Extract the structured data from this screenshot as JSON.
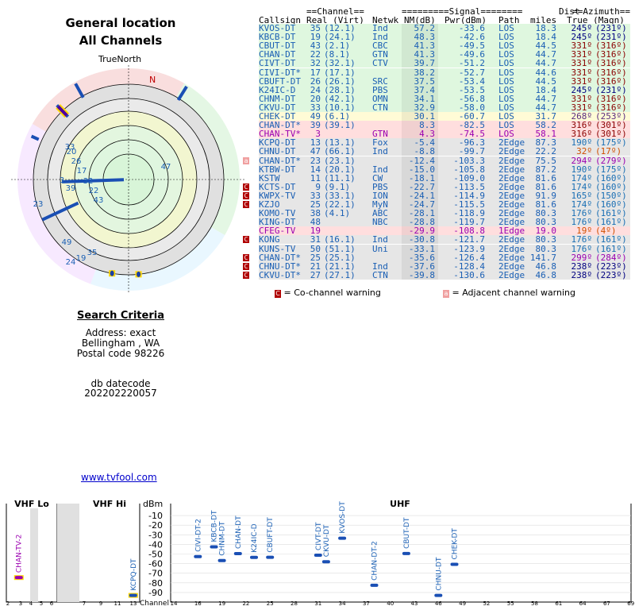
{
  "header": {
    "title1": "General location",
    "title2": "All Channels",
    "north_label": "TrueNorth",
    "magnetic_label": "N"
  },
  "table_headers": {
    "group_channel": "==Channel==",
    "group_signal": "=========Signal========",
    "group_dist": "Dist",
    "group_azimuth": "==Azimuth==",
    "callsign": "Callsign",
    "real_virt": "Real (Virt)",
    "netwk": "Netwk",
    "nm": "NM(dB)",
    "pwr": "Pwr(dBm)",
    "path": "Path",
    "miles": "miles",
    "true_magn": "True (Magn)"
  },
  "stations": [
    {
      "callsign": "KVOS-DT",
      "real": "35",
      "virt": "(12.1)",
      "netwk": "Ind",
      "nm": "57.2",
      "pwr": "-33.6",
      "path": "LOS",
      "dist": "18.3",
      "az": "245º",
      "magn": "(231º)",
      "bg": "#dff7df",
      "color": "#1a5fb4",
      "azcolor": "#000080",
      "warn": ""
    },
    {
      "callsign": "KBCB-DT",
      "real": "19",
      "virt": "(24.1)",
      "netwk": "Ind",
      "nm": "48.3",
      "pwr": "-42.6",
      "path": "LOS",
      "dist": "18.4",
      "az": "245º",
      "magn": "(231º)",
      "bg": "#dff7df",
      "color": "#1a5fb4",
      "azcolor": "#000080",
      "warn": ""
    },
    {
      "callsign": "CBUT-DT",
      "real": "43",
      "virt": "(2.1)",
      "netwk": "CBC",
      "nm": "41.3",
      "pwr": "-49.5",
      "path": "LOS",
      "dist": "44.5",
      "az": "331º",
      "magn": "(316º)",
      "bg": "#dff7df",
      "color": "#1a5fb4",
      "azcolor": "#8b0000",
      "warn": ""
    },
    {
      "callsign": "CHAN-DT",
      "real": "22",
      "virt": "(8.1)",
      "netwk": "GTN",
      "nm": "41.3",
      "pwr": "-49.6",
      "path": "LOS",
      "dist": "44.7",
      "az": "331º",
      "magn": "(316º)",
      "bg": "#dff7df",
      "color": "#1a5fb4",
      "azcolor": "#8b0000",
      "warn": ""
    },
    {
      "callsign": "CIVT-DT",
      "real": "32",
      "virt": "(32.1)",
      "netwk": "CTV",
      "nm": "39.7",
      "pwr": "-51.2",
      "path": "LOS",
      "dist": "44.7",
      "az": "331º",
      "magn": "(316º)",
      "bg": "#dff7df",
      "color": "#1a5fb4",
      "azcolor": "#8b0000",
      "warn": ""
    },
    {
      "callsign": "CIVI-DT*",
      "real": "17",
      "virt": "(17.1)",
      "netwk": "",
      "nm": "38.2",
      "pwr": "-52.7",
      "path": "LOS",
      "dist": "44.6",
      "az": "331º",
      "magn": "(316º)",
      "bg": "#dff7df",
      "color": "#1a5fb4",
      "azcolor": "#8b0000",
      "warn": ""
    },
    {
      "callsign": "CBUFT-DT",
      "real": "26",
      "virt": "(26.1)",
      "netwk": "SRC",
      "nm": "37.5",
      "pwr": "-53.4",
      "path": "LOS",
      "dist": "44.5",
      "az": "331º",
      "magn": "(316º)",
      "bg": "#dff7df",
      "color": "#1a5fb4",
      "azcolor": "#8b0000",
      "warn": ""
    },
    {
      "callsign": "K24IC-D",
      "real": "24",
      "virt": "(28.1)",
      "netwk": "PBS",
      "nm": "37.4",
      "pwr": "-53.5",
      "path": "LOS",
      "dist": "18.4",
      "az": "245º",
      "magn": "(231º)",
      "bg": "#dff7df",
      "color": "#1a5fb4",
      "azcolor": "#000080",
      "warn": ""
    },
    {
      "callsign": "CHNM-DT",
      "real": "20",
      "virt": "(42.1)",
      "netwk": "OMN",
      "nm": "34.1",
      "pwr": "-56.8",
      "path": "LOS",
      "dist": "44.7",
      "az": "331º",
      "magn": "(316º)",
      "bg": "#dff7df",
      "color": "#1a5fb4",
      "azcolor": "#8b0000",
      "warn": ""
    },
    {
      "callsign": "CKVU-DT",
      "real": "33",
      "virt": "(10.1)",
      "netwk": "CTN",
      "nm": "32.9",
      "pwr": "-58.0",
      "path": "LOS",
      "dist": "44.7",
      "az": "331º",
      "magn": "(316º)",
      "bg": "#dff7df",
      "color": "#1a5fb4",
      "azcolor": "#8b0000",
      "warn": ""
    },
    {
      "callsign": "CHEK-DT",
      "real": "49",
      "virt": "(6.1)",
      "netwk": "",
      "nm": "30.1",
      "pwr": "-60.7",
      "path": "LOS",
      "dist": "31.7",
      "az": "268º",
      "magn": "(253º)",
      "bg": "#fffbd6",
      "color": "#1a5fb4",
      "azcolor": "#5a2d82",
      "warn": ""
    },
    {
      "callsign": "CHAN-DT*",
      "real": "39",
      "virt": "(39.1)",
      "netwk": "",
      "nm": "8.3",
      "pwr": "-82.5",
      "path": "LOS",
      "dist": "58.2",
      "az": "316º",
      "magn": "(301º)",
      "bg": "#ffdede",
      "color": "#1a5fb4",
      "azcolor": "#8b0000",
      "warn": ""
    },
    {
      "callsign": "CHAN-TV*",
      "real": "3",
      "virt": "",
      "netwk": "GTN",
      "nm": "4.3",
      "pwr": "-74.5",
      "path": "LOS",
      "dist": "58.1",
      "az": "316º",
      "magn": "(301º)",
      "bg": "#ffdede",
      "color": "#9b00b0",
      "azcolor": "#8b0000",
      "warn": ""
    },
    {
      "callsign": "KCPQ-DT",
      "real": "13",
      "virt": "(13.1)",
      "netwk": "Fox",
      "nm": "-5.4",
      "pwr": "-96.3",
      "path": "2Edge",
      "dist": "87.3",
      "az": "190º",
      "magn": "(175º)",
      "bg": "#e6e6e6",
      "color": "#1a5fb4",
      "azcolor": "#1a6fb4",
      "warn": ""
    },
    {
      "callsign": "CHNU-DT",
      "real": "47",
      "virt": "(66.1)",
      "netwk": "Ind",
      "nm": "-8.8",
      "pwr": "-99.7",
      "path": "2Edge",
      "dist": "22.2",
      "az": "32º",
      "magn": "(17º)",
      "bg": "#e6e6e6",
      "color": "#1a5fb4",
      "azcolor": "#d05000",
      "warn": ""
    },
    {
      "callsign": "CHAN-DT*",
      "real": "23",
      "virt": "(23.1)",
      "netwk": "",
      "nm": "-12.4",
      "pwr": "-103.3",
      "path": "2Edge",
      "dist": "75.5",
      "az": "294º",
      "magn": "(279º)",
      "bg": "#e6e6e6",
      "color": "#1a5fb4",
      "azcolor": "#9b00b0",
      "warn": "adjacent"
    },
    {
      "callsign": "KTBW-DT",
      "real": "14",
      "virt": "(20.1)",
      "netwk": "Ind",
      "nm": "-15.0",
      "pwr": "-105.8",
      "path": "2Edge",
      "dist": "87.2",
      "az": "190º",
      "magn": "(175º)",
      "bg": "#e6e6e6",
      "color": "#1a5fb4",
      "azcolor": "#1a6fb4",
      "warn": ""
    },
    {
      "callsign": "KSTW",
      "real": "11",
      "virt": "(11.1)",
      "netwk": "CW",
      "nm": "-18.1",
      "pwr": "-109.0",
      "path": "2Edge",
      "dist": "81.6",
      "az": "174º",
      "magn": "(160º)",
      "bg": "#e6e6e6",
      "color": "#1a5fb4",
      "azcolor": "#1a6fb4",
      "warn": ""
    },
    {
      "callsign": "KCTS-DT",
      "real": "9",
      "virt": "(9.1)",
      "netwk": "PBS",
      "nm": "-22.7",
      "pwr": "-113.5",
      "path": "2Edge",
      "dist": "81.6",
      "az": "174º",
      "magn": "(160º)",
      "bg": "#e6e6e6",
      "color": "#1a5fb4",
      "azcolor": "#1a6fb4",
      "warn": "co"
    },
    {
      "callsign": "KWPX-TV",
      "real": "33",
      "virt": "(33.1)",
      "netwk": "ION",
      "nm": "-24.1",
      "pwr": "-114.9",
      "path": "2Edge",
      "dist": "91.9",
      "az": "165º",
      "magn": "(150º)",
      "bg": "#e6e6e6",
      "color": "#1a5fb4",
      "azcolor": "#1a6fb4",
      "warn": "co"
    },
    {
      "callsign": "KZJO",
      "real": "25",
      "virt": "(22.1)",
      "netwk": "MyN",
      "nm": "-24.7",
      "pwr": "-115.5",
      "path": "2Edge",
      "dist": "81.6",
      "az": "174º",
      "magn": "(160º)",
      "bg": "#e6e6e6",
      "color": "#1a5fb4",
      "azcolor": "#1a6fb4",
      "warn": "co"
    },
    {
      "callsign": "KOMO-TV",
      "real": "38",
      "virt": "(4.1)",
      "netwk": "ABC",
      "nm": "-28.1",
      "pwr": "-118.9",
      "path": "2Edge",
      "dist": "80.3",
      "az": "176º",
      "magn": "(161º)",
      "bg": "#e6e6e6",
      "color": "#1a5fb4",
      "azcolor": "#1a6fb4",
      "warn": ""
    },
    {
      "callsign": "KING-DT",
      "real": "48",
      "virt": "",
      "netwk": "NBC",
      "nm": "-28.8",
      "pwr": "-119.7",
      "path": "2Edge",
      "dist": "80.3",
      "az": "176º",
      "magn": "(161º)",
      "bg": "#e6e6e6",
      "color": "#1a5fb4",
      "azcolor": "#1a6fb4",
      "warn": ""
    },
    {
      "callsign": "CFEG-TV",
      "real": "19",
      "virt": "",
      "netwk": "",
      "nm": "-29.9",
      "pwr": "-108.8",
      "path": "1Edge",
      "dist": "19.0",
      "az": "19º",
      "magn": "(4º)",
      "bg": "#ffdede",
      "color": "#9b00b0",
      "azcolor": "#d05000",
      "warn": ""
    },
    {
      "callsign": "KONG",
      "real": "31",
      "virt": "(16.1)",
      "netwk": "Ind",
      "nm": "-30.8",
      "pwr": "-121.7",
      "path": "2Edge",
      "dist": "80.3",
      "az": "176º",
      "magn": "(161º)",
      "bg": "#e6e6e6",
      "color": "#1a5fb4",
      "azcolor": "#1a6fb4",
      "warn": "co"
    },
    {
      "callsign": "KUNS-TV",
      "real": "50",
      "virt": "(51.1)",
      "netwk": "Uni",
      "nm": "-33.1",
      "pwr": "-123.9",
      "path": "2Edge",
      "dist": "80.3",
      "az": "176º",
      "magn": "(161º)",
      "bg": "#e6e6e6",
      "color": "#1a5fb4",
      "azcolor": "#1a6fb4",
      "warn": ""
    },
    {
      "callsign": "CHAN-DT*",
      "real": "25",
      "virt": "(25.1)",
      "netwk": "",
      "nm": "-35.6",
      "pwr": "-126.4",
      "path": "2Edge",
      "dist": "141.7",
      "az": "299º",
      "magn": "(284º)",
      "bg": "#e6e6e6",
      "color": "#1a5fb4",
      "azcolor": "#9b00b0",
      "warn": "co"
    },
    {
      "callsign": "CHNU-DT*",
      "real": "21",
      "virt": "(21.1)",
      "netwk": "Ind",
      "nm": "-37.6",
      "pwr": "-128.4",
      "path": "2Edge",
      "dist": "46.8",
      "az": "238º",
      "magn": "(223º)",
      "bg": "#e6e6e6",
      "color": "#1a5fb4",
      "azcolor": "#000080",
      "warn": "co"
    },
    {
      "callsign": "CKVU-DT*",
      "real": "27",
      "virt": "(27.1)",
      "netwk": "CTN",
      "nm": "-39.8",
      "pwr": "-130.6",
      "path": "2Edge",
      "dist": "46.8",
      "az": "238º",
      "magn": "(223º)",
      "bg": "#e6e6e6",
      "color": "#1a5fb4",
      "azcolor": "#000080",
      "warn": "co"
    }
  ],
  "legend": {
    "co_icon": "C",
    "co_text": "= Co-channel warning",
    "adj_icon": "a",
    "adj_text": "= Adjacent channel warning"
  },
  "criteria": {
    "heading": "Search Criteria",
    "address": "Address: exact",
    "city": "Bellingham , WA",
    "postal": "Postal code 98226",
    "db_label": "db datecode",
    "db_value": "202202220057"
  },
  "link": {
    "text": "www.tvfool.com"
  },
  "polar": {
    "rings_dbm": [
      "LOS ring 1",
      "ring 2",
      "ring 3",
      "ring 4",
      "ring 5",
      "ring 6"
    ],
    "markers": [
      {
        "ch": "33",
        "az": 331
      },
      {
        "ch": "20",
        "az": 331
      },
      {
        "ch": "26",
        "az": 331
      },
      {
        "ch": "3",
        "az": 316
      },
      {
        "ch": "17",
        "az": 331
      },
      {
        "ch": "32",
        "az": 331
      },
      {
        "ch": "39",
        "az": 316
      },
      {
        "ch": "22",
        "az": 331
      },
      {
        "ch": "43",
        "az": 331
      },
      {
        "ch": "47",
        "az": 32
      },
      {
        "ch": "23",
        "az": 294
      },
      {
        "ch": "49",
        "az": 268
      },
      {
        "ch": "35",
        "az": 245
      },
      {
        "ch": "19",
        "az": 245
      },
      {
        "ch": "24",
        "az": 245
      },
      {
        "ch": "13",
        "az": 190
      },
      {
        "ch": "14",
        "az": 190
      },
      {
        "ch": "11",
        "az": 174
      }
    ]
  },
  "chart_data": {
    "type": "bar",
    "title": "",
    "ylabel": "dBm",
    "xlabel": "Channel",
    "ylim": [
      -95,
      -5
    ],
    "yticks": [
      "-10",
      "-20",
      "-30",
      "-40",
      "-50",
      "-60",
      "-70",
      "-80",
      "-90"
    ],
    "bands": [
      {
        "name": "VHF Lo"
      },
      {
        "name": "VHF Hi"
      },
      {
        "name": "UHF"
      }
    ],
    "vhf_lo_ticks": [
      "2",
      "3",
      "4",
      "5",
      "6"
    ],
    "vhf_hi_ticks": [
      "7",
      "9",
      "11",
      "13"
    ],
    "uhf_ticks": [
      "14",
      "16",
      "19",
      "22",
      "25",
      "28",
      "31",
      "34",
      "37",
      "40",
      "43",
      "46",
      "49",
      "52",
      "55",
      "58",
      "61",
      "64",
      "67",
      "69"
    ],
    "points": [
      {
        "label": "CHAN-TV-2",
        "channel": 3,
        "dbm": -74.5,
        "color": "#9b00b0"
      },
      {
        "label": "KCPQ-DT",
        "channel": 13,
        "dbm": -96.3,
        "color": "#1a5fb4"
      },
      {
        "label": "CIVI-DT-2",
        "channel": 17,
        "dbm": -52.7,
        "color": "#1a5fb4"
      },
      {
        "label": "KBCB-DT",
        "channel": 19,
        "dbm": -42.6,
        "color": "#1a5fb4"
      },
      {
        "label": "CHNM-DT",
        "channel": 20,
        "dbm": -56.8,
        "color": "#1a5fb4"
      },
      {
        "label": "CHAN-DT",
        "channel": 22,
        "dbm": -49.6,
        "color": "#1a5fb4"
      },
      {
        "label": "K24IC-D",
        "channel": 24,
        "dbm": -53.5,
        "color": "#1a5fb4"
      },
      {
        "label": "CBUFT-DT",
        "channel": 26,
        "dbm": -53.4,
        "color": "#1a5fb4"
      },
      {
        "label": "CIVT-DT",
        "channel": 32,
        "dbm": -51.2,
        "color": "#1a5fb4"
      },
      {
        "label": "CKVU-DT",
        "channel": 33,
        "dbm": -58.0,
        "color": "#1a5fb4"
      },
      {
        "label": "KVOS-DT",
        "channel": 35,
        "dbm": -33.6,
        "color": "#1a5fb4"
      },
      {
        "label": "CHAN-DT-2",
        "channel": 39,
        "dbm": -82.5,
        "color": "#1a5fb4"
      },
      {
        "label": "CBUT-DT",
        "channel": 43,
        "dbm": -49.5,
        "color": "#1a5fb4"
      },
      {
        "label": "CHNU-DT",
        "channel": 47,
        "dbm": -99.7,
        "color": "#1a5fb4"
      },
      {
        "label": "CHEK-DT",
        "channel": 49,
        "dbm": -60.7,
        "color": "#1a5fb4"
      }
    ]
  }
}
